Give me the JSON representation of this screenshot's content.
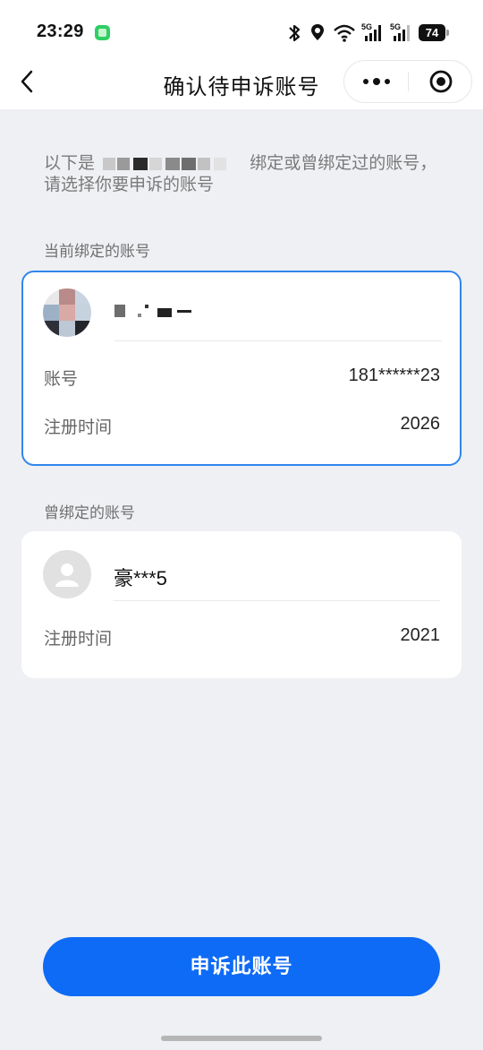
{
  "status_bar": {
    "time": "23:29",
    "battery": "74",
    "signal_1_label": "5G",
    "signal_2_label": "5G"
  },
  "nav": {
    "title": "确认待申诉账号",
    "more_icon": "more-dots-icon",
    "close_icon": "target-close-icon",
    "back_icon": "chevron-left-icon"
  },
  "intro": {
    "prefix": "以下是",
    "suffix": "绑定或曾绑定过的账号，请选择你要申诉的账号"
  },
  "current": {
    "section_label": "当前绑定的账号",
    "account_label": "账号",
    "account_value": "181******23",
    "register_label": "注册时间",
    "register_value": "2026"
  },
  "previous": {
    "section_label": "曾绑定的账号",
    "nickname": "豪***5",
    "register_label": "注册时间",
    "register_value": "2021"
  },
  "appeal_button": "申诉此账号",
  "colors": {
    "accent": "#0e6bf5",
    "selected_border": "#2f86ee",
    "page_bg": "#eef0f3"
  }
}
